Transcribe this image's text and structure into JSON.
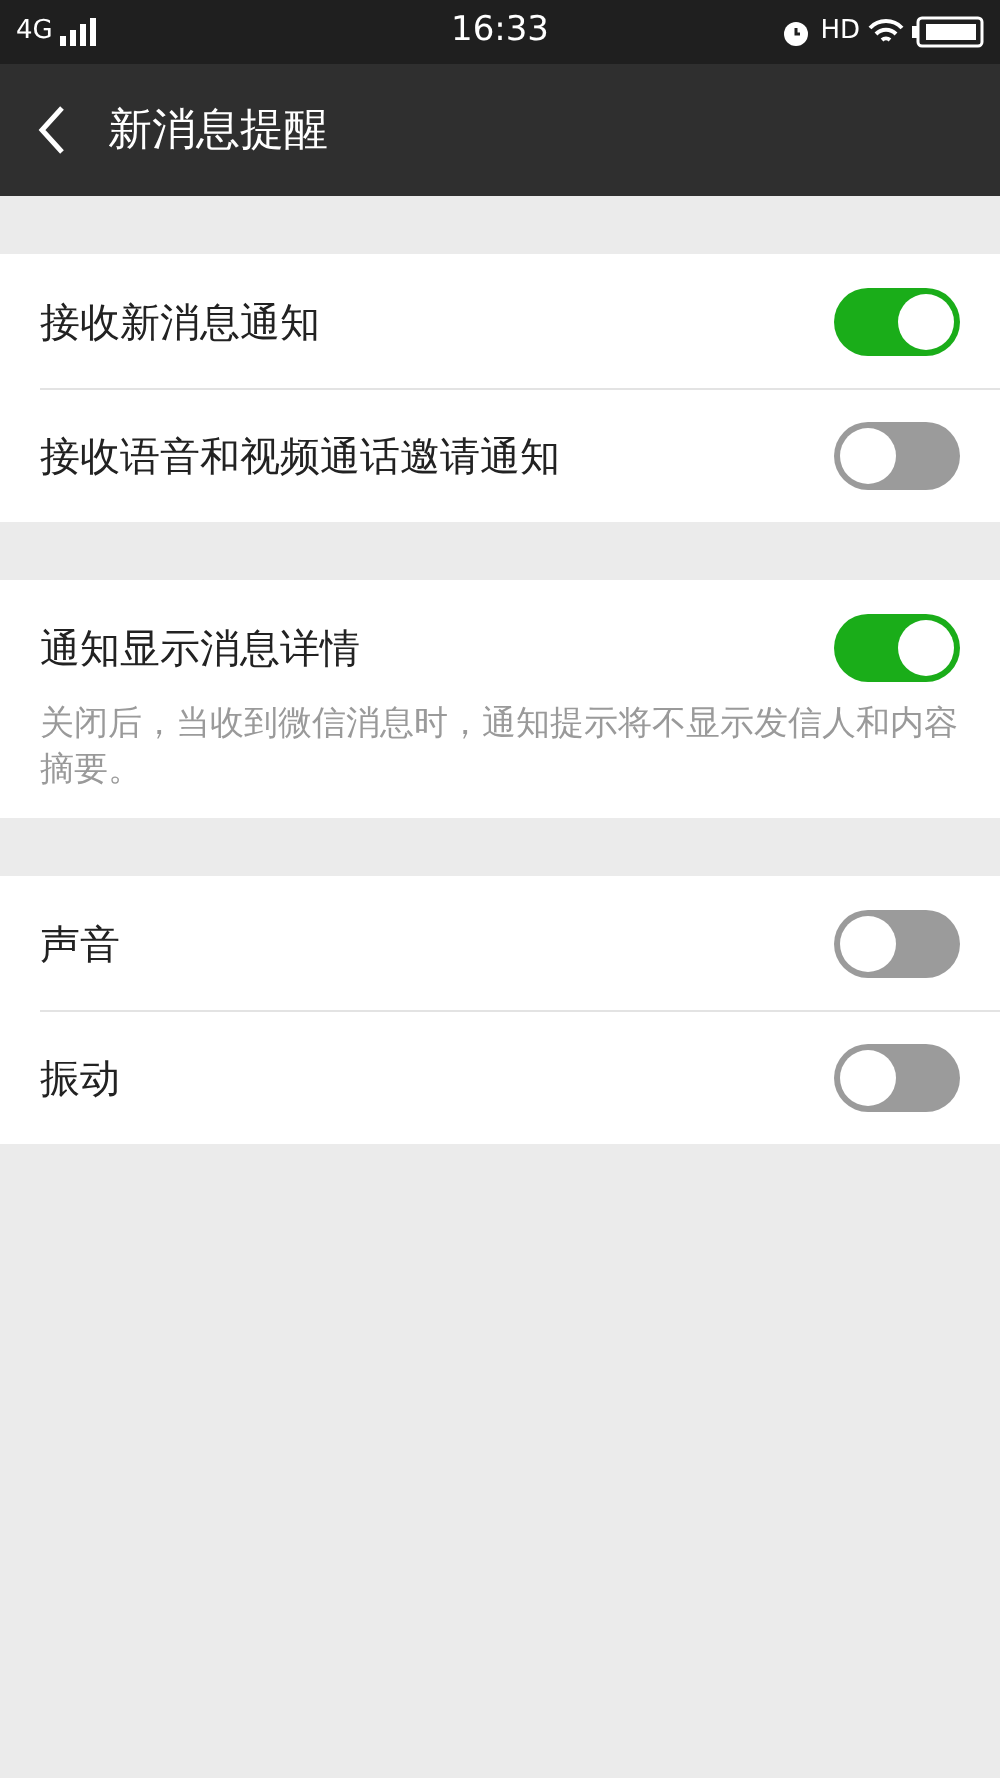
{
  "status_bar": {
    "network": "4G",
    "time": "16:33",
    "hd": "HD"
  },
  "header": {
    "title": "新消息提醒"
  },
  "groups": [
    {
      "items": [
        {
          "label": "接收新消息通知",
          "on": true
        },
        {
          "label": "接收语音和视频通话邀请通知",
          "on": false
        }
      ]
    },
    {
      "items": [
        {
          "label": "通知显示消息详情",
          "on": true
        }
      ],
      "note": "关闭后，当收到微信消息时，通知提示将不显示发信人和内容摘要。"
    },
    {
      "items": [
        {
          "label": "声音",
          "on": false
        },
        {
          "label": "振动",
          "on": false
        }
      ]
    }
  ]
}
